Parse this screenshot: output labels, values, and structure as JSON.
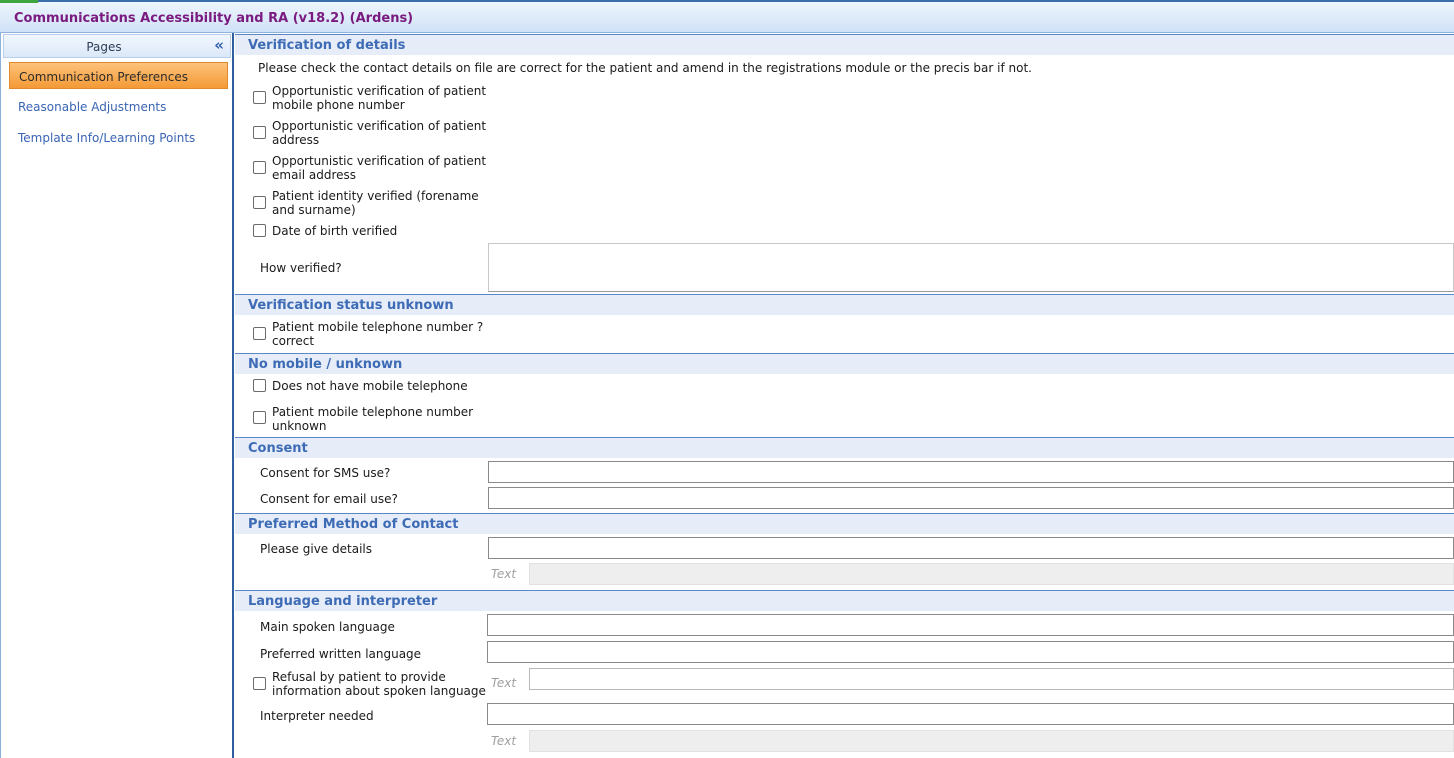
{
  "window": {
    "title": "Communications Accessibility and RA (v18.2) (Ardens)"
  },
  "sidebar": {
    "header": "Pages",
    "collapse_glyph": "«",
    "items": [
      {
        "label": "Communication Preferences",
        "active": true
      },
      {
        "label": "Reasonable Adjustments",
        "active": false
      },
      {
        "label": "Template Info/Learning Points",
        "active": false
      }
    ]
  },
  "sections": {
    "verification": {
      "title": "Verification of details",
      "instruction": "Please check the contact details on file are correct for the patient and amend in the registrations module or the precis bar if not.",
      "checkboxes": [
        {
          "label": "Opportunistic verification of patient mobile phone number",
          "checked": false
        },
        {
          "label": "Opportunistic verification of patient address",
          "checked": false
        },
        {
          "label": "Opportunistic verification of patient email address",
          "checked": false
        },
        {
          "label": "Patient identity verified (forename and surname)",
          "checked": false
        },
        {
          "label": "Date of birth verified",
          "checked": false
        }
      ],
      "how_verified_label": "How verified?",
      "how_verified_value": ""
    },
    "status_unknown": {
      "title": "Verification status unknown",
      "checkboxes": [
        {
          "label": "Patient mobile telephone number ? correct",
          "checked": false
        }
      ]
    },
    "no_mobile": {
      "title": "No mobile / unknown",
      "checkboxes": [
        {
          "label": "Does not have mobile telephone",
          "checked": false
        },
        {
          "label": "Patient mobile telephone number unknown",
          "checked": false
        }
      ]
    },
    "consent": {
      "title": "Consent",
      "sms_label": "Consent for SMS use?",
      "sms_value": "",
      "email_label": "Consent for email use?",
      "email_value": ""
    },
    "preferred": {
      "title": "Preferred Method of Contact",
      "details_label": "Please give details",
      "details_value": "",
      "text_hint": "Text"
    },
    "language": {
      "title": "Language and interpreter",
      "main_spoken_label": "Main spoken language",
      "preferred_written_label": "Preferred written language",
      "refusal_label": "Refusal by patient to provide information about spoken language",
      "refusal_checked": false,
      "refusal_text_hint": "Text",
      "interpreter_label": "Interpreter needed",
      "interpreter_text_hint": "Text"
    }
  }
}
